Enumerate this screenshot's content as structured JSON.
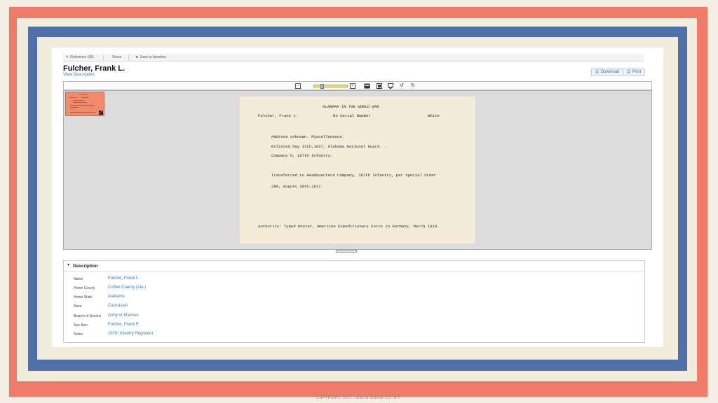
{
  "toolbar": {
    "reference_url": "Reference URL",
    "share": "Share",
    "save_favorites": "Save to favorites"
  },
  "record": {
    "title": "Fulcher, Frank L.",
    "view_description": "View Description"
  },
  "actions": {
    "download": "Download",
    "print": "Print"
  },
  "viewer": {
    "zoom_level": 0.2
  },
  "card": {
    "heading": "ALABAMA IN THE WORLD WAR",
    "name": "Fulcher, Frank L.",
    "serial": "No Serial Number",
    "race": "White",
    "line1": "Address unknown.  Miscellaneous.",
    "line2": "Enlisted May 11th,1917, Alabama National Guard. .",
    "line3": "Company H, 167th Infantry.",
    "line4": "Transferred to Headquarters Company, 167th Infantry, per Special Order",
    "line5": "289, August 28th,1917.",
    "authority": "Authority:  Typed Roster, American Expeditionary Force in Germany, March 1919."
  },
  "description": {
    "header": "Description",
    "rows": [
      {
        "label": "Name",
        "value": "Fulcher, Frank L."
      },
      {
        "label": "Home County",
        "value": "Coffee County (Ala.)"
      },
      {
        "label": "Home State",
        "value": "Alabama"
      },
      {
        "label": "Race",
        "value": "Caucasian"
      },
      {
        "label": "Branch of Service",
        "value": "Army or Marines"
      },
      {
        "label": "See Also",
        "value": "Fulcher, Frank F."
      },
      {
        "label": "Notes",
        "value": "167th Infantry Regiment"
      }
    ]
  },
  "copyright": "COPYRIGHT, 1917, LESLIE-JUDGE CO.,N.Y.",
  "colors": {
    "frame_red": "#ef7b6a",
    "frame_blue": "#4e6fa8",
    "frame_cream": "#f2ecdd",
    "link_blue": "#3b78b5"
  }
}
